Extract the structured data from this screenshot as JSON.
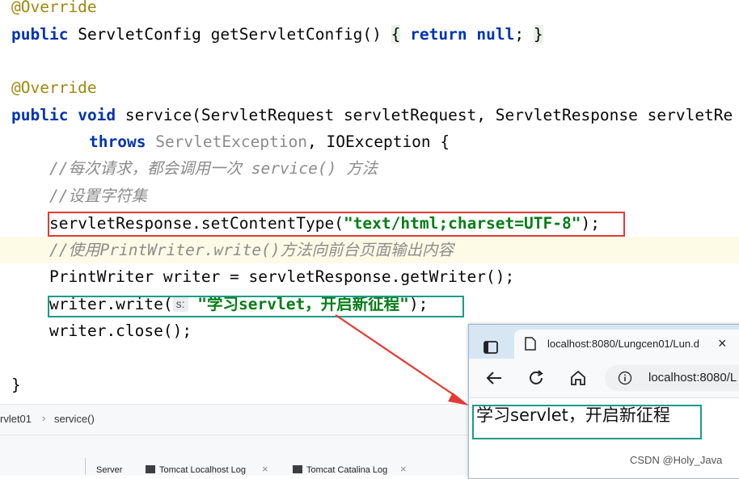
{
  "code": {
    "override1": "@Override",
    "getconfig": {
      "kw_public": "public",
      "type": "ServletConfig",
      "method": "getServletConfig()",
      "open": "{",
      "kw_return": "return",
      "kw_null": "null",
      "semi": ";",
      "close": "}"
    },
    "override2": "@Override",
    "service": {
      "kw_public": "public",
      "kw_void": "void",
      "sig": "service(ServletRequest servletRequest, ServletResponse servletRe"
    },
    "throws_line": {
      "kw_throws": "throws",
      "exc1": "ServletException",
      "rest": ", IOException {"
    },
    "comment1": "//每次请求，都会调用一次 service() 方法",
    "comment2": "//设置字符集",
    "set_content": {
      "pre": "servletResponse.setContentType(",
      "str": "\"text/html;charset=UTF-8\"",
      "post": ");"
    },
    "comment3": "//使用PrintWriter.write()方法向前台页面输出内容",
    "writer_decl": "PrintWriter writer = servletResponse.getWriter();",
    "write_call": {
      "pre": "writer.write(",
      "hint": "s:",
      "str": "\"学习servlet，开启新征程\"",
      "post": ");"
    },
    "close_call": "writer.close();",
    "class_close": "}"
  },
  "breadcrumb": {
    "item1": "rvlet01",
    "sep": "›",
    "item2": "service()"
  },
  "bottom_tabs": {
    "tab1": "Server",
    "tab2": "Tomcat Localhost Log",
    "tab3": "Tomcat Catalina Log",
    "close": "×"
  },
  "browser": {
    "tab_title": "localhost:8080/Lungcen01/Lun.d",
    "tab_close": "×",
    "address": "localhost:8080/L",
    "content": "学习servlet，开启新征程"
  },
  "watermark": "CSDN @Holy_Java",
  "colors": {
    "red_box": "#e53935",
    "teal_box": "#1a9a8a",
    "arrow": "#e53935"
  }
}
